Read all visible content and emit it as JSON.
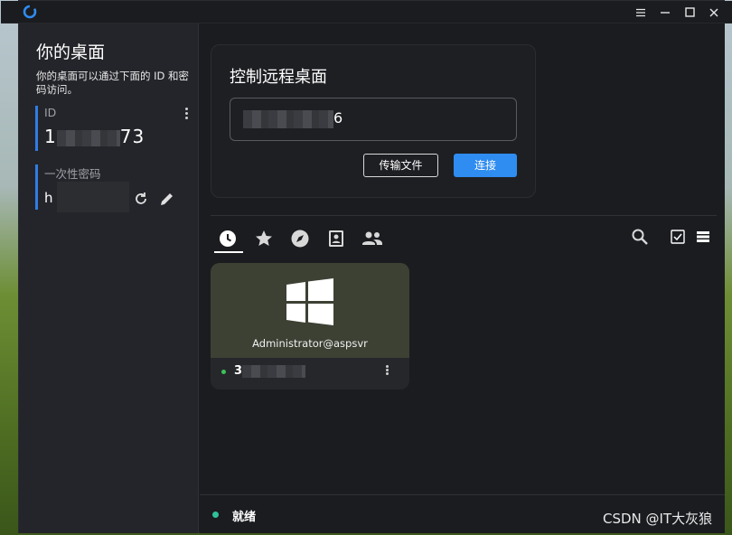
{
  "window": {
    "controls": [
      "menu",
      "minimize",
      "maximize",
      "close"
    ]
  },
  "left_panel": {
    "title": "你的桌面",
    "description": "你的桌面可以通过下面的 ID 和密码访问。",
    "id_field": {
      "label": "ID",
      "value_start": "1",
      "value_end": "73"
    },
    "password_field": {
      "label": "一次性密码",
      "value_start": "h"
    }
  },
  "connect_card": {
    "title": "控制远程桌面",
    "input_value_end": "6",
    "transfer_button": "传输文件",
    "connect_button": "连接"
  },
  "tabs": [
    {
      "name": "recent",
      "icon": "clock-icon",
      "active": true
    },
    {
      "name": "favorites",
      "icon": "star-icon"
    },
    {
      "name": "discovered",
      "icon": "compass-icon"
    },
    {
      "name": "address-book",
      "icon": "contact-book-icon"
    },
    {
      "name": "group",
      "icon": "group-icon"
    }
  ],
  "toolbar": {
    "icons": [
      "search-icon",
      "checkbox-icon",
      "list-view-icon"
    ]
  },
  "peers": [
    {
      "name": "Administrator@aspsvr",
      "id_start": "3",
      "os": "windows",
      "online": true
    }
  ],
  "status": {
    "text": "就绪"
  },
  "watermark": "CSDN @IT大灰狼",
  "colors": {
    "accent": "#2f8cf0",
    "status_ready": "#2fc29a",
    "online": "#3cc25a"
  }
}
